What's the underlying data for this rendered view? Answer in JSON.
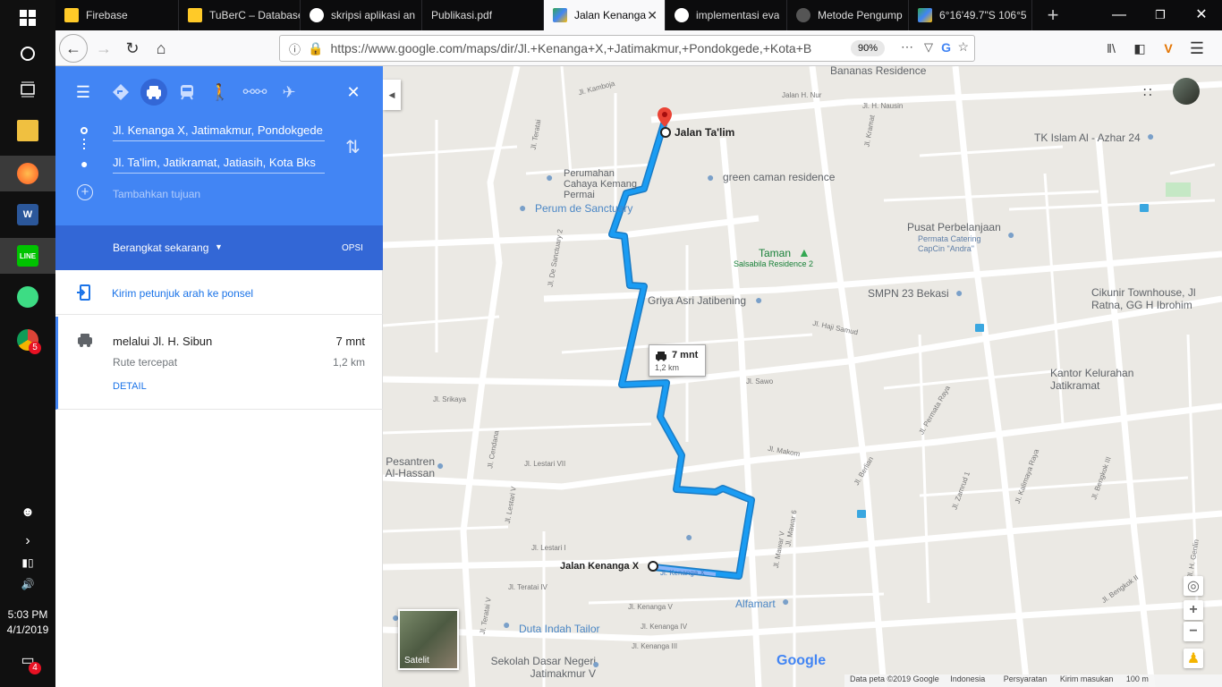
{
  "taskbar": {
    "clock_time": "5:03 PM",
    "clock_date": "4/1/2019",
    "chrome_badge": "5",
    "notif_count": "4",
    "icons": [
      "windows-start-icon",
      "cortana-icon",
      "task-view-icon",
      "file-explorer-icon",
      "firefox-icon",
      "word-icon",
      "line-icon",
      "android-studio-icon",
      "chrome-icon"
    ]
  },
  "browser": {
    "tabs": [
      {
        "label": "Firebase"
      },
      {
        "label": "TuBerC – Database"
      },
      {
        "label": "skripsi aplikasi an"
      },
      {
        "label": "Publikasi.pdf"
      },
      {
        "label": "Jalan Kenanga"
      },
      {
        "label": "implementasi eva"
      },
      {
        "label": "Metode Pengump"
      },
      {
        "label": "6°16'49.7\"S 106°5"
      }
    ],
    "new_tab": "+",
    "url": "https://www.google.com/maps/dir/Jl.+Kenanga+X,+Jatimakmur,+Pondokgede,+Kota+B",
    "zoom": "90%"
  },
  "panel": {
    "origin": "Jl. Kenanga X, Jatimakmur, Pondokgede",
    "destination": "Jl. Ta'lim, Jatikramat, Jatiasih, Kota Bks",
    "add_destination": "Tambahkan tujuan",
    "depart": "Berangkat sekarang",
    "options": "OPSI",
    "send_to_phone": "Kirim petunjuk arah ke ponsel",
    "route_name": "melalui Jl. H. Sibun",
    "route_desc": "Rute tercepat",
    "route_time": "7 mnt",
    "route_dist": "1,2 km",
    "details": "DETAIL"
  },
  "map": {
    "callout_time": "7 mnt",
    "callout_dist": "1,2 km",
    "dest_label": "Jalan Ta'lim",
    "origin_label": "Jalan Kenanga X",
    "satelit": "Satelit",
    "google": "Google",
    "footer": [
      "Data peta ©2019 Google",
      "Indonesia",
      "Persyaratan",
      "Kirim masukan",
      "100 m"
    ],
    "places": [
      "Bananas Residence",
      "TK Islam Al - Azhar 24",
      "Perumahan Cahaya Kemang Permai",
      "green caman residence",
      "Perum de Sanctuary",
      "Pusat Perbelanjaan",
      "Permata Catering CapCin \"Andra\"",
      "Taman",
      "Salsabila Residence 2",
      "Griya Asri Jatibening",
      "SMPN 23 Bekasi",
      "Cikunir Townhouse, Jl Ratna, GG H Ibrohim",
      "Kantor Kelurahan Jatikramat",
      "Pesantren Al-Hassan",
      "Alfamart",
      "Duta Indah Tailor",
      "Sekolah Dasar Negeri Jatimakmur V"
    ],
    "streets": [
      "Jl. Kamboja",
      "Jalan H. Nur",
      "Jl. H. Nausin",
      "Jl. Teratai",
      "Jl. Kramat",
      "Jl. De Sanctuary 2",
      "Jl. Haji Samud",
      "Jl. Sawo",
      "Jl. Srikaya",
      "Jl. Makom",
      "Jl. Lestari VII",
      "Jl. Cendana",
      "Jl. Lestari V",
      "Jl. Lestari I",
      "Jl. Teratai IV",
      "Jl. Kenanga V",
      "Jl. Kenanga IV",
      "Jl. Kenanga III",
      "Jl. Teratai V",
      "Jl. Mawar V",
      "Jl. Mawar 6",
      "Jl. Kenanga X",
      "Jl. Berlian",
      "Jl. Permata Raya",
      "Jl. Zamrud 1",
      "Jl. Kalimaya Raya",
      "Jl. Bengkok III",
      "Jl. Bengkok II",
      "Jl. H. Genlin"
    ]
  },
  "colors": {
    "route": "#1a9cf3",
    "header": "#4285f4",
    "header_dark": "#3367d6",
    "pin": "#ea4335",
    "poi": "#7aa0c9",
    "park": "#34a853"
  }
}
